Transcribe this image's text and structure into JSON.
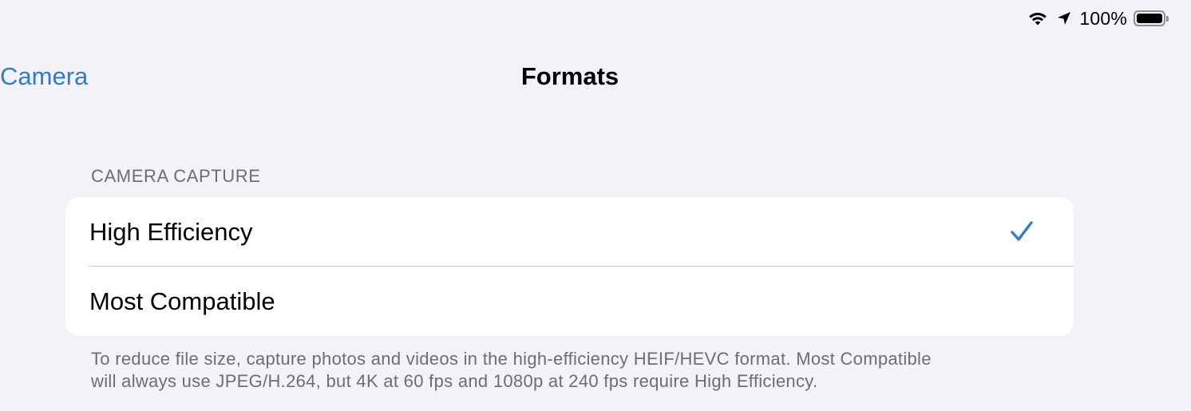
{
  "status_bar": {
    "battery_percent": "100%",
    "battery_level": 1.0,
    "icons": [
      "wifi-icon",
      "location-arrow-icon",
      "battery-icon"
    ]
  },
  "nav": {
    "back_label": "Camera",
    "title": "Formats"
  },
  "section": {
    "header": "CAMERA CAPTURE",
    "options": [
      {
        "label": "High Efficiency",
        "selected": true
      },
      {
        "label": "Most Compatible",
        "selected": false
      }
    ],
    "footer_line1": "To reduce file size, capture photos and videos in the high-efficiency HEIF/HEVC format. Most Compatible",
    "footer_line2": "will always use JPEG/H.264, but 4K at 60 fps and 1080p at 240 fps require High Efficiency."
  },
  "colors": {
    "accent": "#2f7ad6",
    "background": "#f2f2f7",
    "secondary_text": "#6d6d72"
  }
}
